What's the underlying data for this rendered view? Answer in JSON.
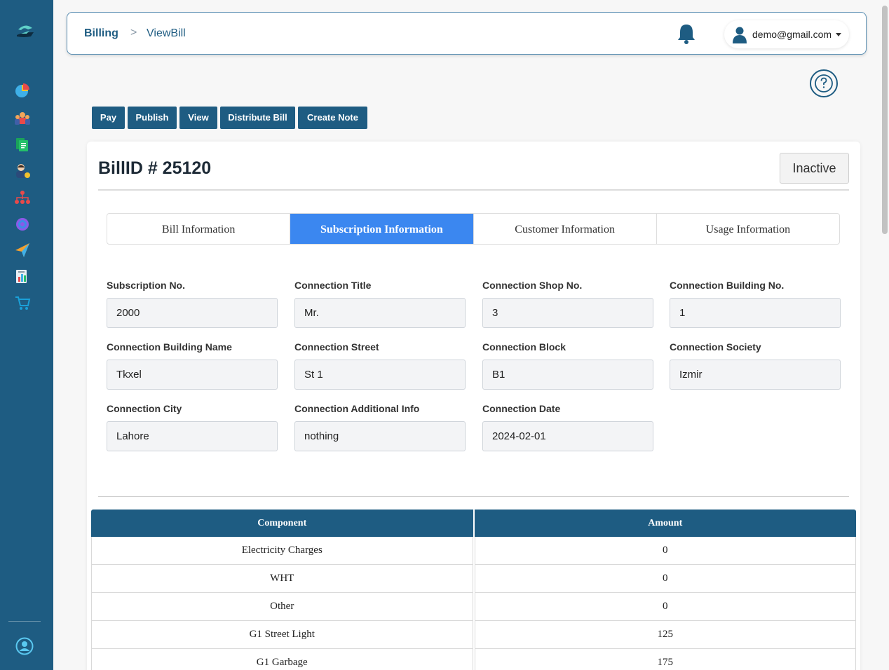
{
  "header": {
    "breadcrumb_home": "Billing",
    "breadcrumb_separator": ">",
    "breadcrumb_current": "ViewBill",
    "user_email": "demo@gmail.com"
  },
  "actions": {
    "pay": "Pay",
    "publish": "Publish",
    "view": "View",
    "distribute": "Distribute Bill",
    "create_note": "Create Note"
  },
  "bill": {
    "title": "BillID # 25120",
    "status": "Inactive"
  },
  "tabs": [
    {
      "label": "Bill Information"
    },
    {
      "label": "Subscription Information"
    },
    {
      "label": "Customer Information"
    },
    {
      "label": "Usage Information"
    }
  ],
  "fields": [
    {
      "label": "Subscription No.",
      "value": "2000"
    },
    {
      "label": "Connection Title",
      "value": "Mr."
    },
    {
      "label": "Connection Shop No.",
      "value": "3"
    },
    {
      "label": "Connection Building No.",
      "value": "1"
    },
    {
      "label": "Connection Building Name",
      "value": "Tkxel"
    },
    {
      "label": "Connection Street",
      "value": "St 1"
    },
    {
      "label": "Connection Block",
      "value": "B1"
    },
    {
      "label": "Connection Society",
      "value": "Izmir"
    },
    {
      "label": "Connection City",
      "value": "Lahore"
    },
    {
      "label": "Connection Additional Info",
      "value": "nothing"
    },
    {
      "label": "Connection Date",
      "value": "2024-02-01"
    }
  ],
  "table": {
    "headers": [
      "Component",
      "Amount"
    ],
    "rows": [
      [
        "Electricity Charges",
        "0"
      ],
      [
        "WHT",
        "0"
      ],
      [
        "Other",
        "0"
      ],
      [
        "G1 Street Light",
        "125"
      ],
      [
        "G1 Garbage",
        "175"
      ]
    ]
  },
  "colors": {
    "brand": "#1e5c82",
    "active_tab": "#3b87f0"
  },
  "icons": {
    "sidebar": [
      "dashboard-pie-icon",
      "team-icon",
      "document-icon",
      "customer-icon",
      "hierarchy-icon",
      "settings-gear-icon",
      "send-plane-icon",
      "report-icon",
      "cart-icon"
    ]
  }
}
